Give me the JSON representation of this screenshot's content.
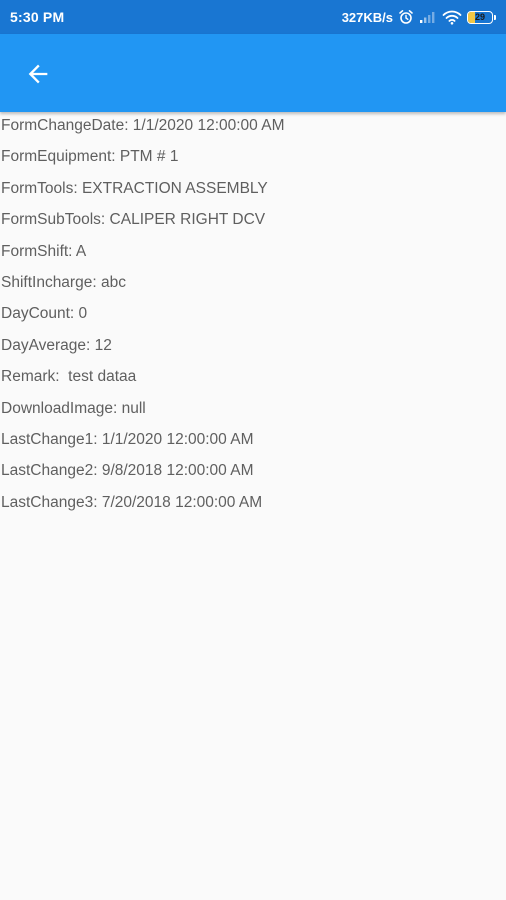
{
  "status_bar": {
    "time": "5:30 PM",
    "net_speed": "327KB/s",
    "battery_level": "29",
    "battery_fraction": 0.29,
    "icons": [
      "alarm-icon",
      "signal-icon",
      "wifi-icon",
      "battery-icon"
    ]
  },
  "app_bar": {
    "back_icon": "arrow-left-icon",
    "color": "#2196f3"
  },
  "colors": {
    "status_bar": "#1976d2",
    "app_bar": "#2196f3",
    "text": "#5f5f5f",
    "background": "#fafafa",
    "battery_fill": "#f2c744"
  },
  "details": [
    "FormChangeDate: 1/1/2020 12:00:00 AM",
    "FormEquipment: PTM # 1",
    "FormTools: EXTRACTION ASSEMBLY",
    "FormSubTools: CALIPER RIGHT DCV",
    "FormShift: A",
    "ShiftIncharge: abc",
    "DayCount: 0",
    "DayAverage: 12",
    "Remark:  test dataa",
    "DownloadImage: null",
    "LastChange1: 1/1/2020 12:00:00 AM",
    "LastChange2: 9/8/2018 12:00:00 AM",
    "LastChange3: 7/20/2018 12:00:00 AM"
  ]
}
